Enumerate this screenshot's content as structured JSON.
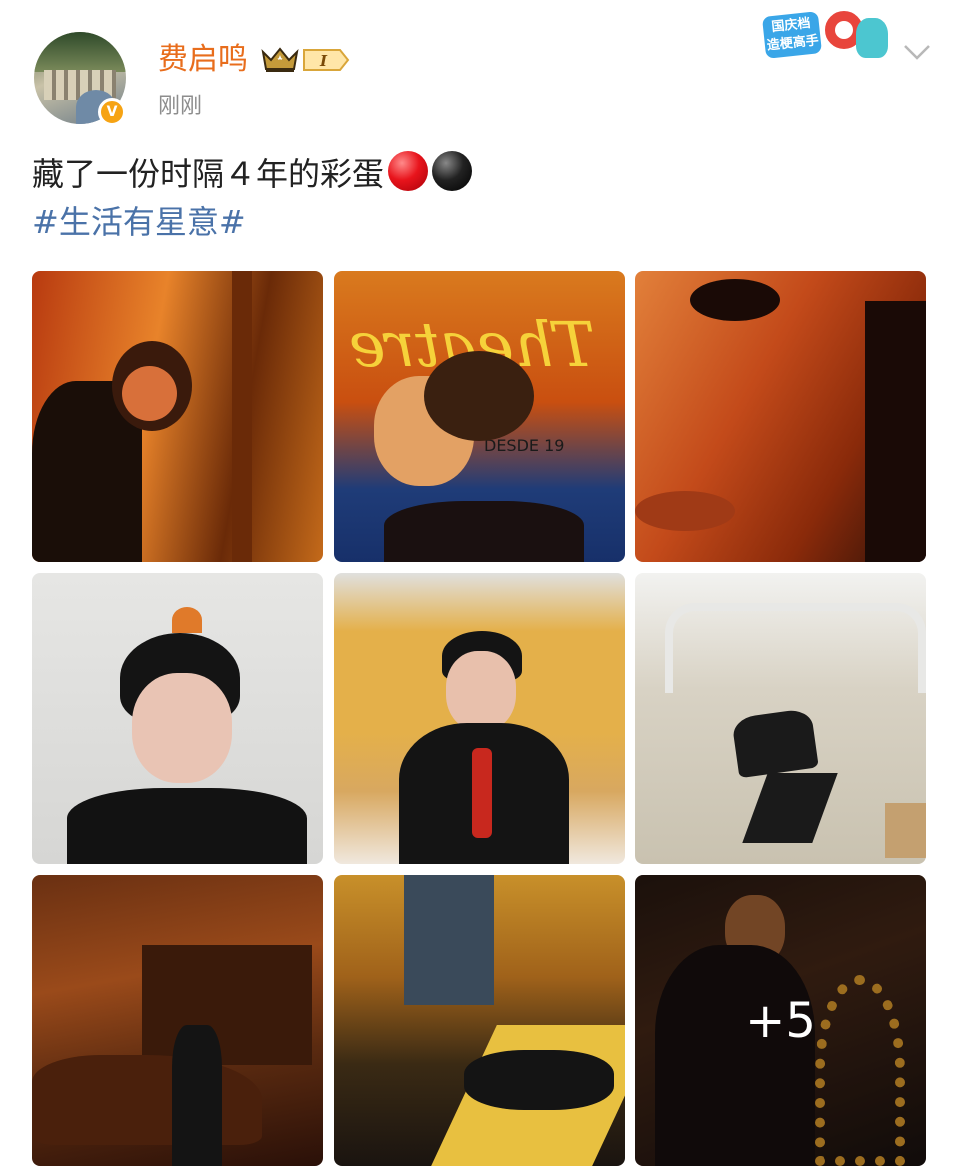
{
  "post": {
    "username": "费启鸣",
    "level_label": "I",
    "timestamp": "刚刚",
    "text_line1": "藏了一份时隔４年的彩蛋",
    "hashtag": "#生活有星意#",
    "verified_badge": "V",
    "emojis": [
      "red-circle",
      "black-circle"
    ]
  },
  "promo_badge": {
    "text": "国庆档 造梗高手"
  },
  "photos": {
    "count_visible": 9,
    "more_label": "+5",
    "items": [
      {
        "id": 1,
        "theme": "orange-mirror"
      },
      {
        "id": 2,
        "theme": "theatre-poster",
        "overlay_text_1": "Theatre",
        "overlay_text_2": "DESDE 19"
      },
      {
        "id": 3,
        "theme": "closeup-eye"
      },
      {
        "id": 4,
        "theme": "white-wall-portrait"
      },
      {
        "id": 5,
        "theme": "yellow-wall-sitting"
      },
      {
        "id": 6,
        "theme": "white-room-jump"
      },
      {
        "id": 7,
        "theme": "dark-car-night"
      },
      {
        "id": 8,
        "theme": "lying-on-table"
      },
      {
        "id": 9,
        "theme": "dark-piano-lights"
      }
    ]
  },
  "colors": {
    "username": "#e86d1c",
    "hashtag": "#4a72a8",
    "timestamp": "#8d8d8d",
    "verified": "#f6a313"
  },
  "icons": [
    "crown-icon",
    "level-badge-icon",
    "chevron-down-icon",
    "verified-icon"
  ]
}
